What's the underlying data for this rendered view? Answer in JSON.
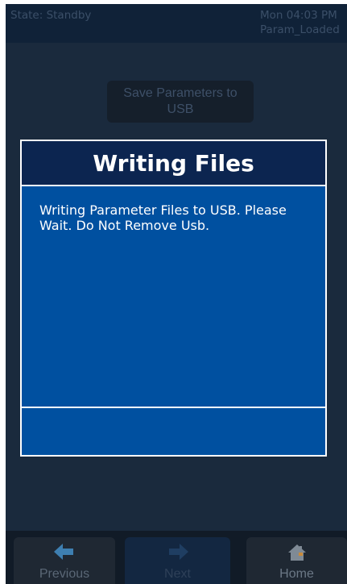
{
  "status": {
    "state": "State: Standby",
    "time": "Mon 04:03 PM",
    "param": "Param_Loaded"
  },
  "action": {
    "save_line1": "Save Parameters to",
    "save_line2": "USB"
  },
  "dialog": {
    "title": "Writing Files",
    "message": "Writing Parameter Files to USB. Please Wait. Do Not Remove Usb."
  },
  "nav": {
    "previous": "Previous",
    "next": "Next",
    "home": "Home"
  },
  "icons": {
    "previous": "arrow-left-icon",
    "next": "arrow-right-icon",
    "home": "house-icon"
  },
  "colors": {
    "dialog_body": "#0050a0",
    "dialog_header": "#0c2550",
    "screen_bg": "#1a2a3d"
  }
}
